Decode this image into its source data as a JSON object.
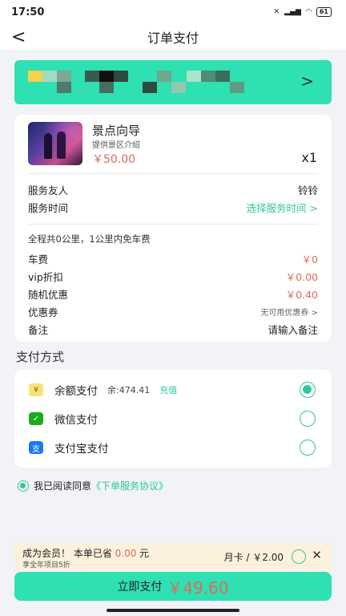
{
  "status_bar": {
    "time": "17:50",
    "battery": "61"
  },
  "nav": {
    "title": "订单支付"
  },
  "product": {
    "name": "景点向导",
    "desc": "提供景区介绍",
    "price": "￥50.00",
    "qty": "x1"
  },
  "service": {
    "friend_label": "服务友人",
    "friend_value": "铃铃",
    "time_label": "服务时间",
    "time_value": "选择服务时间 >"
  },
  "fees": {
    "distance": "全程共0公里，1公里内免车费",
    "car_label": "车费",
    "car_value": "￥0",
    "vip_label": "vip折扣",
    "vip_value": "￥0.00",
    "random_label": "随机优惠",
    "random_value": "￥0.40",
    "coupon_label": "优惠券",
    "coupon_value": "无可用优惠券 >",
    "note_label": "备注",
    "note_value": "请输入备注"
  },
  "payment": {
    "section_title": "支付方式",
    "balance_label": "余额支付",
    "balance_amount": "余:474.41",
    "recharge": "充值",
    "wechat_label": "微信支付",
    "alipay_label": "支付宝支付",
    "selected": "balance"
  },
  "agreement": {
    "prefix": "我已阅读同意",
    "link": "《下单服务协议》"
  },
  "member": {
    "title_pre": "成为会员！ 本单已省 ",
    "saved": "0.00",
    "title_post": " 元",
    "sub": "享全年项目5折",
    "card": "月卡 / ￥2.00"
  },
  "pay_button": {
    "label": "立即支付",
    "amount": "￥49.60"
  },
  "colors": {
    "accent": "#2ee0b2",
    "price": "#e06a5c"
  }
}
